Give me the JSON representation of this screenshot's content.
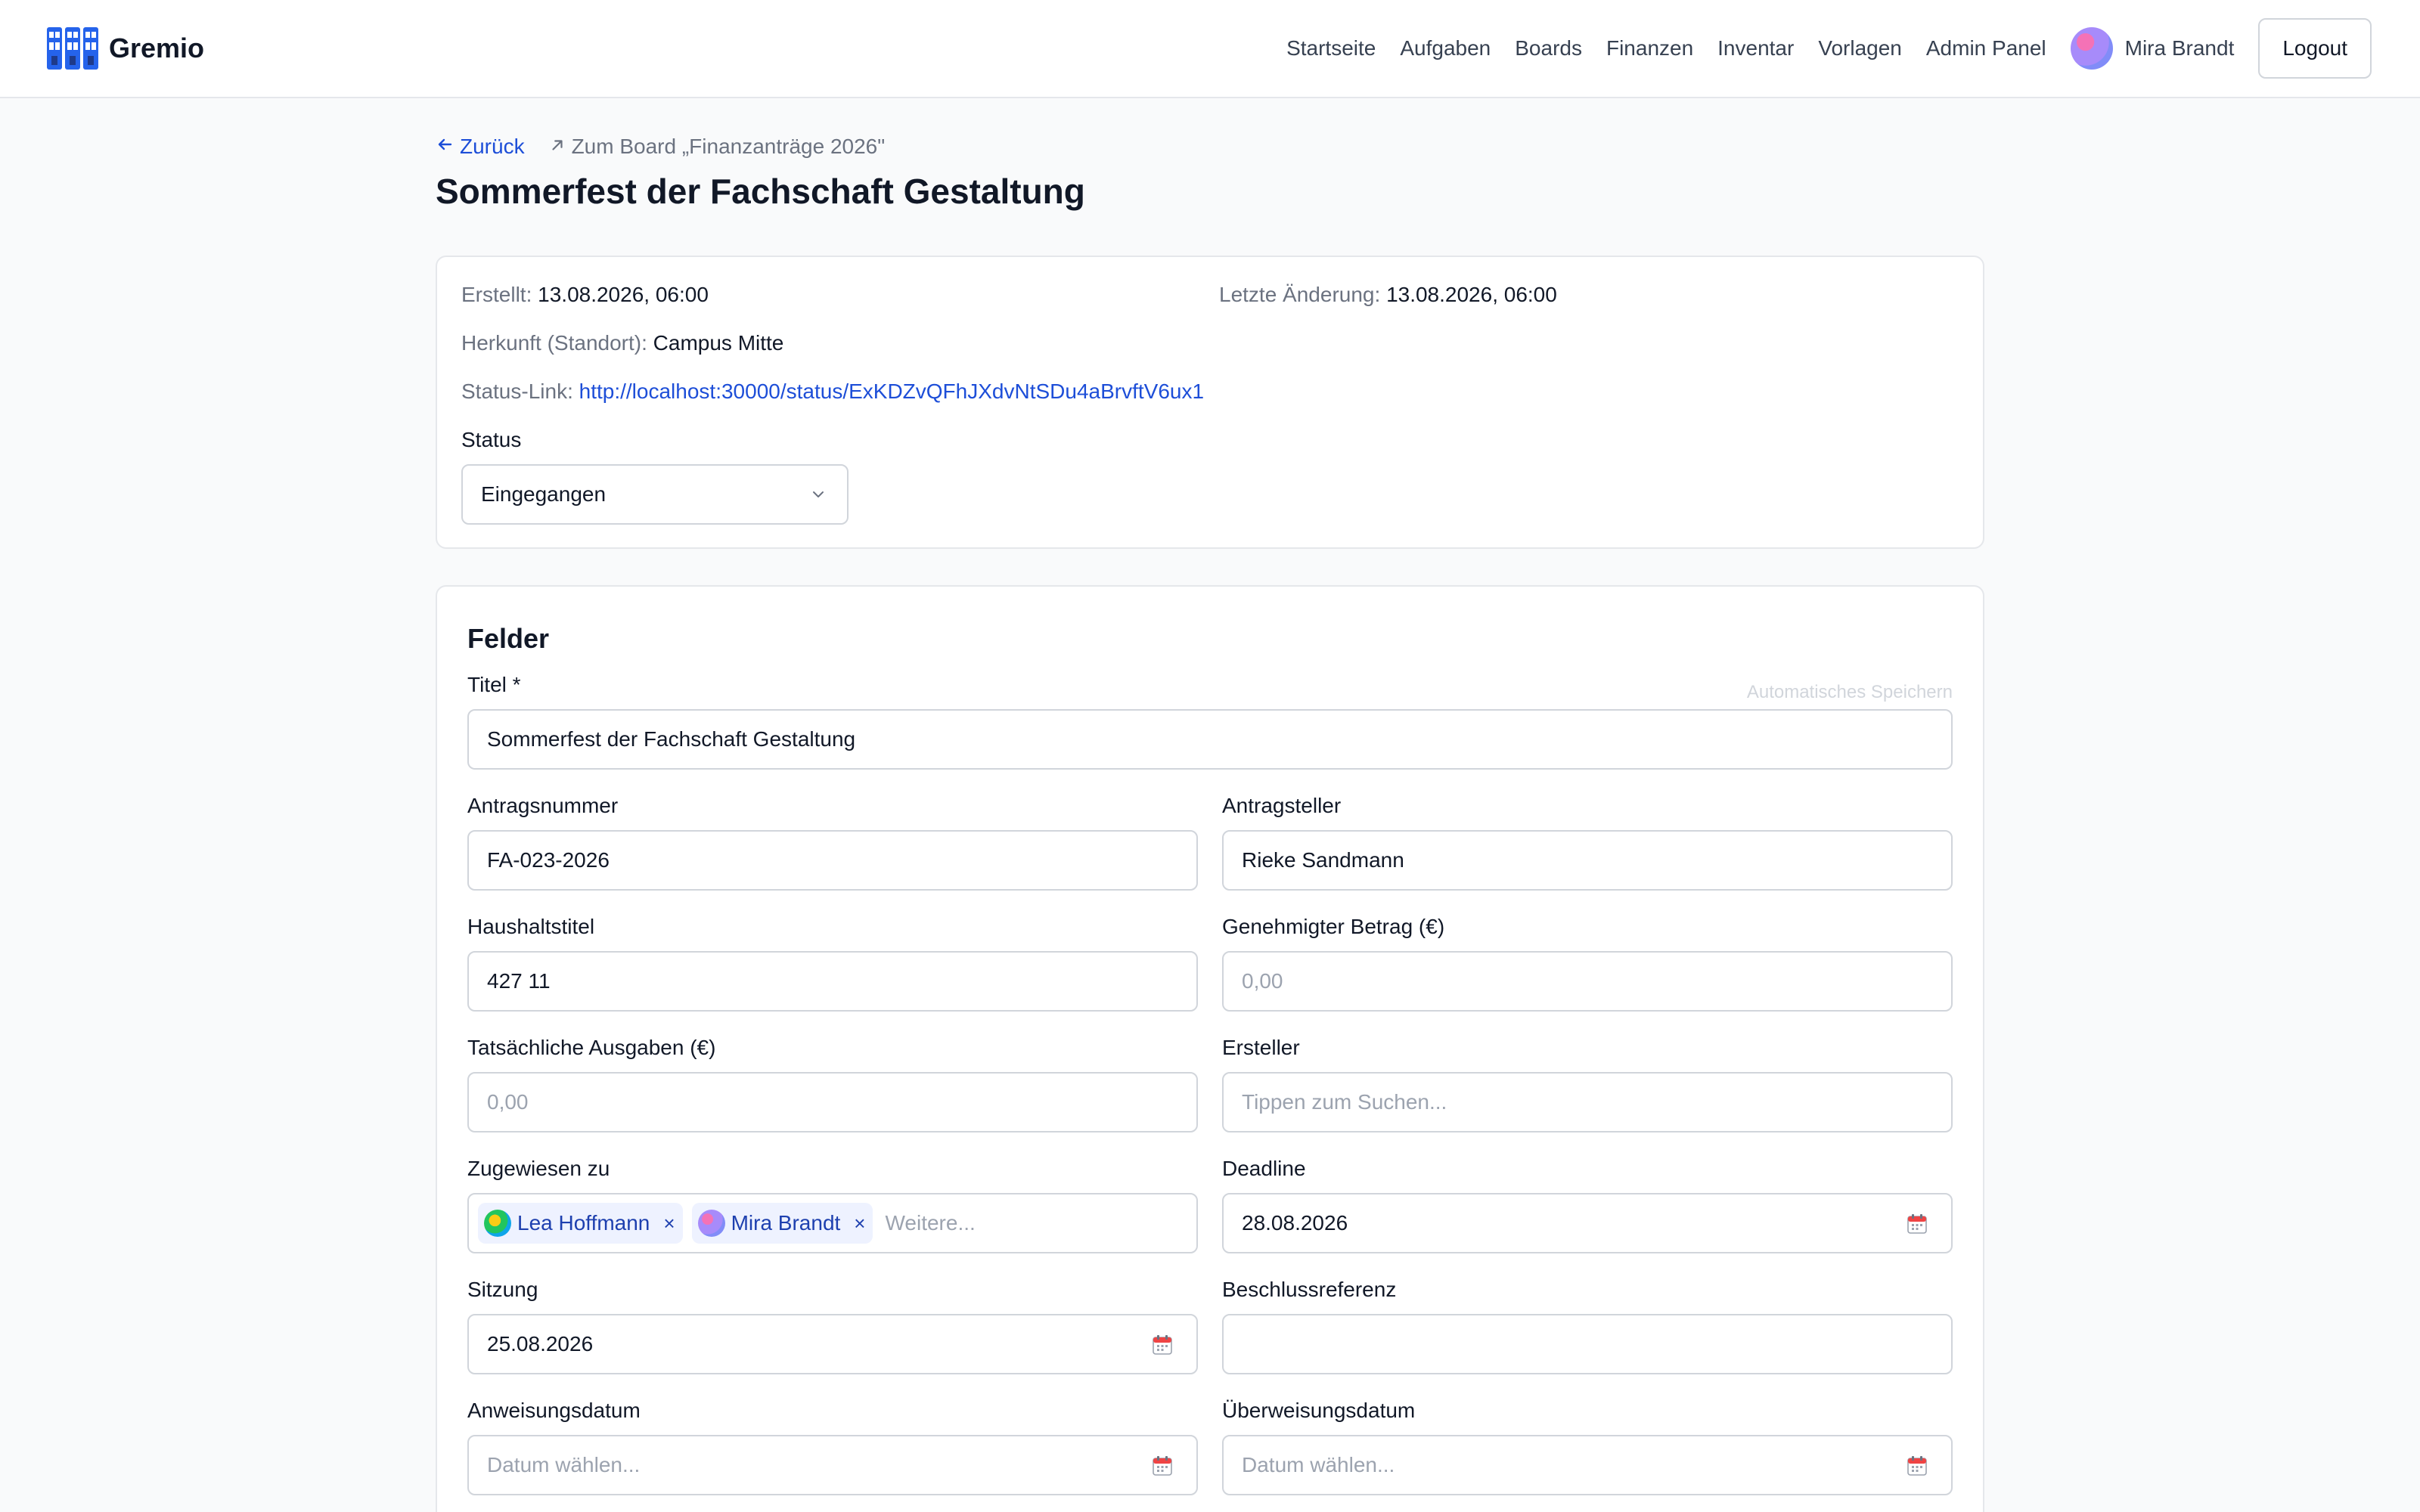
{
  "app": {
    "name": "Gremio"
  },
  "nav": {
    "items": [
      "Startseite",
      "Aufgaben",
      "Boards",
      "Finanzen",
      "Inventar",
      "Vorlagen",
      "Admin Panel"
    ],
    "user_name": "Mira Brandt",
    "logout_label": "Logout"
  },
  "breadcrumb": {
    "back_label": "Zurück",
    "board_label": "Zum Board „Finanzanträge 2026\""
  },
  "page": {
    "title": "Sommerfest der Fachschaft Gestaltung"
  },
  "meta": {
    "created_label": "Erstellt:",
    "created_value": "13.08.2026, 06:00",
    "modified_label": "Letzte Änderung:",
    "modified_value": "13.08.2026, 06:00",
    "origin_label": "Herkunft (Standort):",
    "origin_value": "Campus Mitte",
    "status_link_label": "Status-Link:",
    "status_link_value": "http://localhost:30000/status/ExKDZvQFhJXdvNtSDu4aBrvftV6ux1",
    "status_label": "Status",
    "status_value": "Eingegangen"
  },
  "fields": {
    "section_title": "Felder",
    "autosave_label": "Automatisches Speichern",
    "titel": {
      "label": "Titel *",
      "value": "Sommerfest der Fachschaft Gestaltung"
    },
    "antragsnummer": {
      "label": "Antragsnummer",
      "value": "FA-023-2026"
    },
    "antragsteller": {
      "label": "Antragsteller",
      "value": "Rieke Sandmann"
    },
    "haushaltstitel": {
      "label": "Haushaltstitel",
      "value": "427 11"
    },
    "genehmigter_betrag": {
      "label": "Genehmigter Betrag (€)",
      "placeholder": "0,00"
    },
    "tatsaechliche_ausgaben": {
      "label": "Tatsächliche Ausgaben (€)",
      "placeholder": "0,00"
    },
    "ersteller": {
      "label": "Ersteller",
      "placeholder": "Tippen zum Suchen..."
    },
    "zugewiesen": {
      "label": "Zugewiesen zu",
      "chips": [
        "Lea Hoffmann",
        "Mira Brandt"
      ],
      "chip_remove": "×",
      "placeholder": "Weitere..."
    },
    "deadline": {
      "label": "Deadline",
      "value": "28.08.2026"
    },
    "sitzung": {
      "label": "Sitzung",
      "value": "25.08.2026"
    },
    "beschlussreferenz": {
      "label": "Beschlussreferenz",
      "value": ""
    },
    "anweisungsdatum": {
      "label": "Anweisungsdatum",
      "placeholder": "Datum wählen..."
    },
    "ueberweisungsdatum": {
      "label": "Überweisungsdatum",
      "placeholder": "Datum wählen..."
    }
  },
  "colors": {
    "accent": "#1d4ed8",
    "chip_bg": "#eef2ff",
    "border": "#d1d5db"
  },
  "icons": {
    "logo": "gremio-logo-icon",
    "back": "arrow-left-icon",
    "board": "arrow-up-right-icon",
    "select": "chevron-down-icon",
    "date": "calendar-icon",
    "remove": "close-icon"
  }
}
